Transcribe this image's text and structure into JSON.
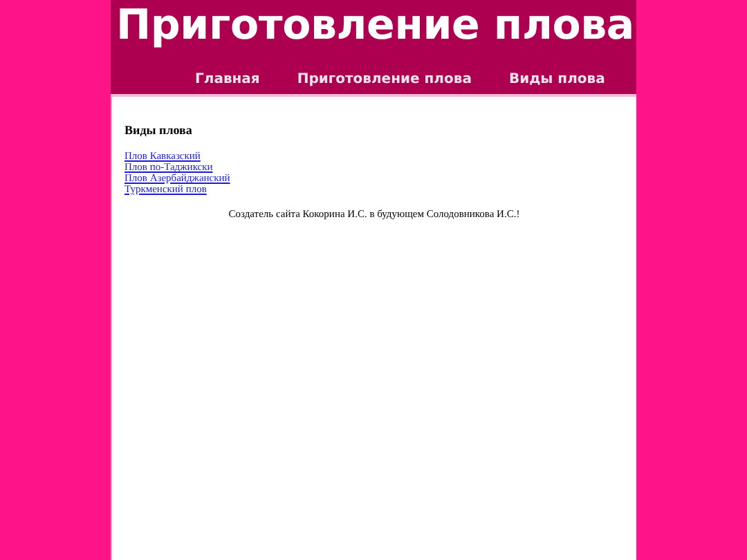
{
  "header": {
    "title": "Приготовление плова"
  },
  "nav": [
    {
      "label": "Главная"
    },
    {
      "label": "Приготовление плова"
    },
    {
      "label": "Виды плова"
    }
  ],
  "content": {
    "heading": "Виды плова",
    "links": [
      "Плов Кавказский",
      "Плов по-Таджикски",
      "Плов Азербайджанский",
      "Туркменский плов"
    ],
    "footer": "Создатель сайта Кокорина И.С. в будующем Солодовникова И.С.!"
  }
}
